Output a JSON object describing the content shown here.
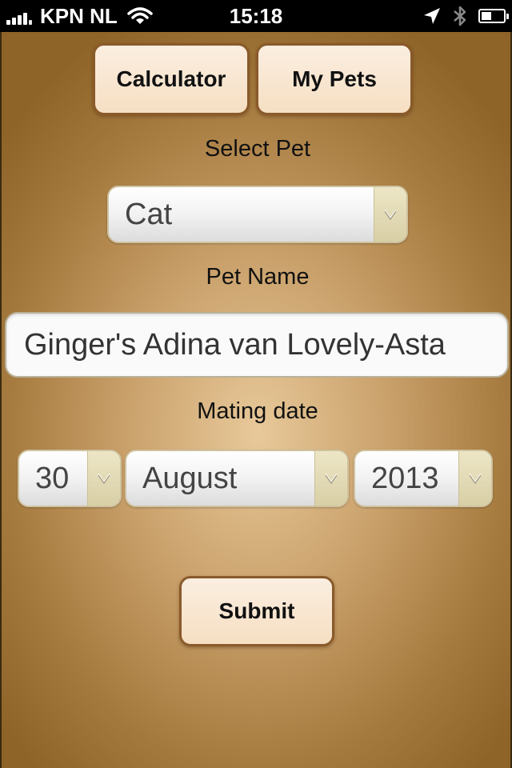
{
  "status_bar": {
    "carrier": "KPN NL",
    "time": "15:18",
    "icons": [
      "signal-icon",
      "wifi-icon",
      "location-arrow-icon",
      "bluetooth-icon",
      "battery-icon"
    ]
  },
  "nav": {
    "calculator_label": "Calculator",
    "my_pets_label": "My Pets"
  },
  "form": {
    "select_pet_label": "Select Pet",
    "pet_type_value": "Cat",
    "pet_name_label": "Pet Name",
    "pet_name_value": "Ginger's Adina van Lovely-Asta",
    "mating_date_label": "Mating date",
    "day_value": "30",
    "month_value": "August",
    "year_value": "2013",
    "submit_label": "Submit"
  },
  "colors": {
    "background_center": "#e8c99a",
    "background_edge": "#8e6428",
    "button_fill": "#f8e6cf",
    "button_border": "#8a5a2a",
    "status_bar": "#000000"
  }
}
